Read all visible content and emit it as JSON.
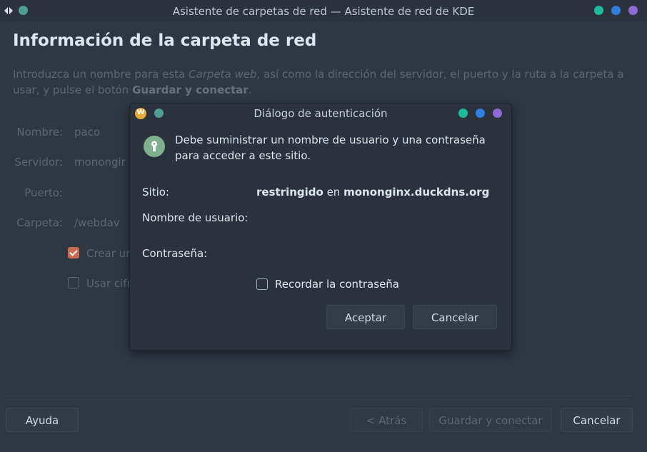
{
  "window": {
    "title": "Asistente de carpetas de red — Asistente de red de KDE",
    "colors": {
      "teal": "#1abc9c",
      "blue": "#2f7ee0",
      "purple": "#8e6ad8"
    }
  },
  "page": {
    "heading": "Información de la carpeta de red",
    "intro_1": "Introduzca un nombre para esta ",
    "intro_em": "Carpeta web",
    "intro_2": ", así como la dirección del servidor, el puerto y la ruta a la carpeta a usar, y pulse el botón ",
    "intro_bold": "Guardar y conectar",
    "intro_3": "."
  },
  "form": {
    "name_label": "Nombre:",
    "name_value": "paco",
    "server_label": "Servidor:",
    "server_value": "monongir",
    "port_label": "Puerto:",
    "folder_label": "Carpeta:",
    "folder_value": "/webdav",
    "create_shortcut_label": "Crear ur",
    "create_shortcut_checked": true,
    "encryption_label": "Usar cifr",
    "encryption_checked": false
  },
  "footer": {
    "help": "Ayuda",
    "back": "< Atrás",
    "save_connect": "Guardar y conectar",
    "cancel": "Cancelar"
  },
  "dialog": {
    "title": "Diálogo de autenticación",
    "message": "Debe suministrar un nombre de usuario y una contraseña para acceder a este sitio.",
    "site_label": "Sitio:",
    "site_realm": "restringido",
    "site_connector": " en ",
    "site_host": "mononginx.duckdns.org",
    "username_label": "Nombre de usuario:",
    "username_value": "",
    "password_label": "Contraseña:",
    "password_value": "",
    "remember_label": "Recordar la contraseña",
    "remember_checked": false,
    "ok": "Aceptar",
    "cancel": "Cancelar",
    "app_icon_letter": "W"
  }
}
